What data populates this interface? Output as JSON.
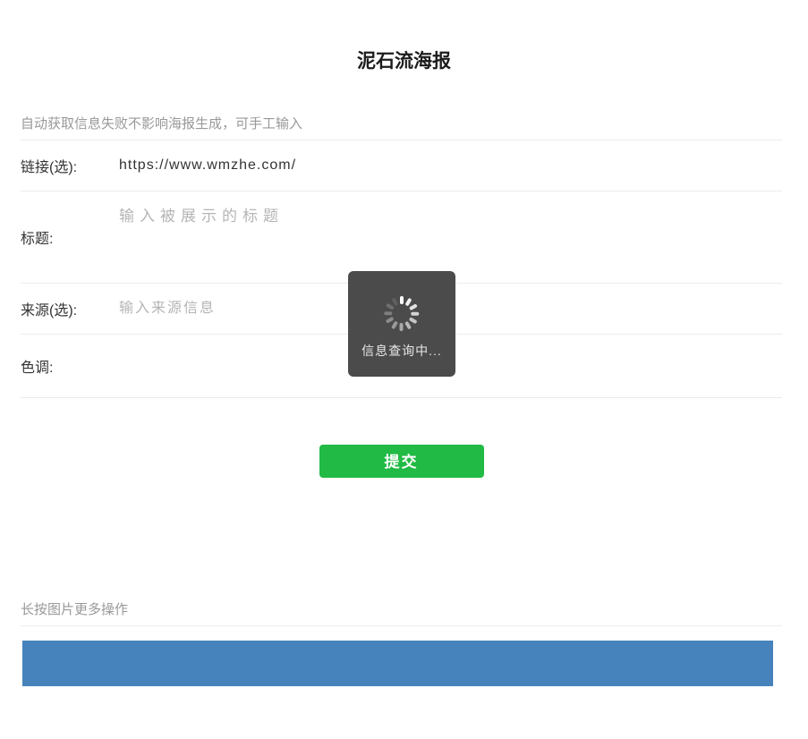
{
  "page": {
    "title": "泥石流海报",
    "hint": "自动获取信息失败不影响海报生成，可手工输入",
    "footer_hint": "长按图片更多操作"
  },
  "form": {
    "fields": [
      {
        "id": "link",
        "label": "链接(选):",
        "value": "https://www.wmzhe.com/",
        "placeholder": ""
      },
      {
        "id": "title",
        "label": "标题:",
        "value": "",
        "placeholder": "输入被展示的标题"
      },
      {
        "id": "source",
        "label": "来源(选):",
        "value": "",
        "placeholder": "输入来源信息"
      },
      {
        "id": "tone",
        "label": "色调:",
        "value": "#4683BC"
      }
    ],
    "submit_label": "提交"
  },
  "toast": {
    "message": "信息查询中...",
    "icon": "loading-spinner-icon"
  },
  "poster_preview": {
    "color": "#4683BC"
  },
  "colors": {
    "accent_blue": "#4683BC",
    "submit_green": "#21BA45",
    "toast_bg": "#4B4B4B",
    "separator": "#ececec"
  }
}
